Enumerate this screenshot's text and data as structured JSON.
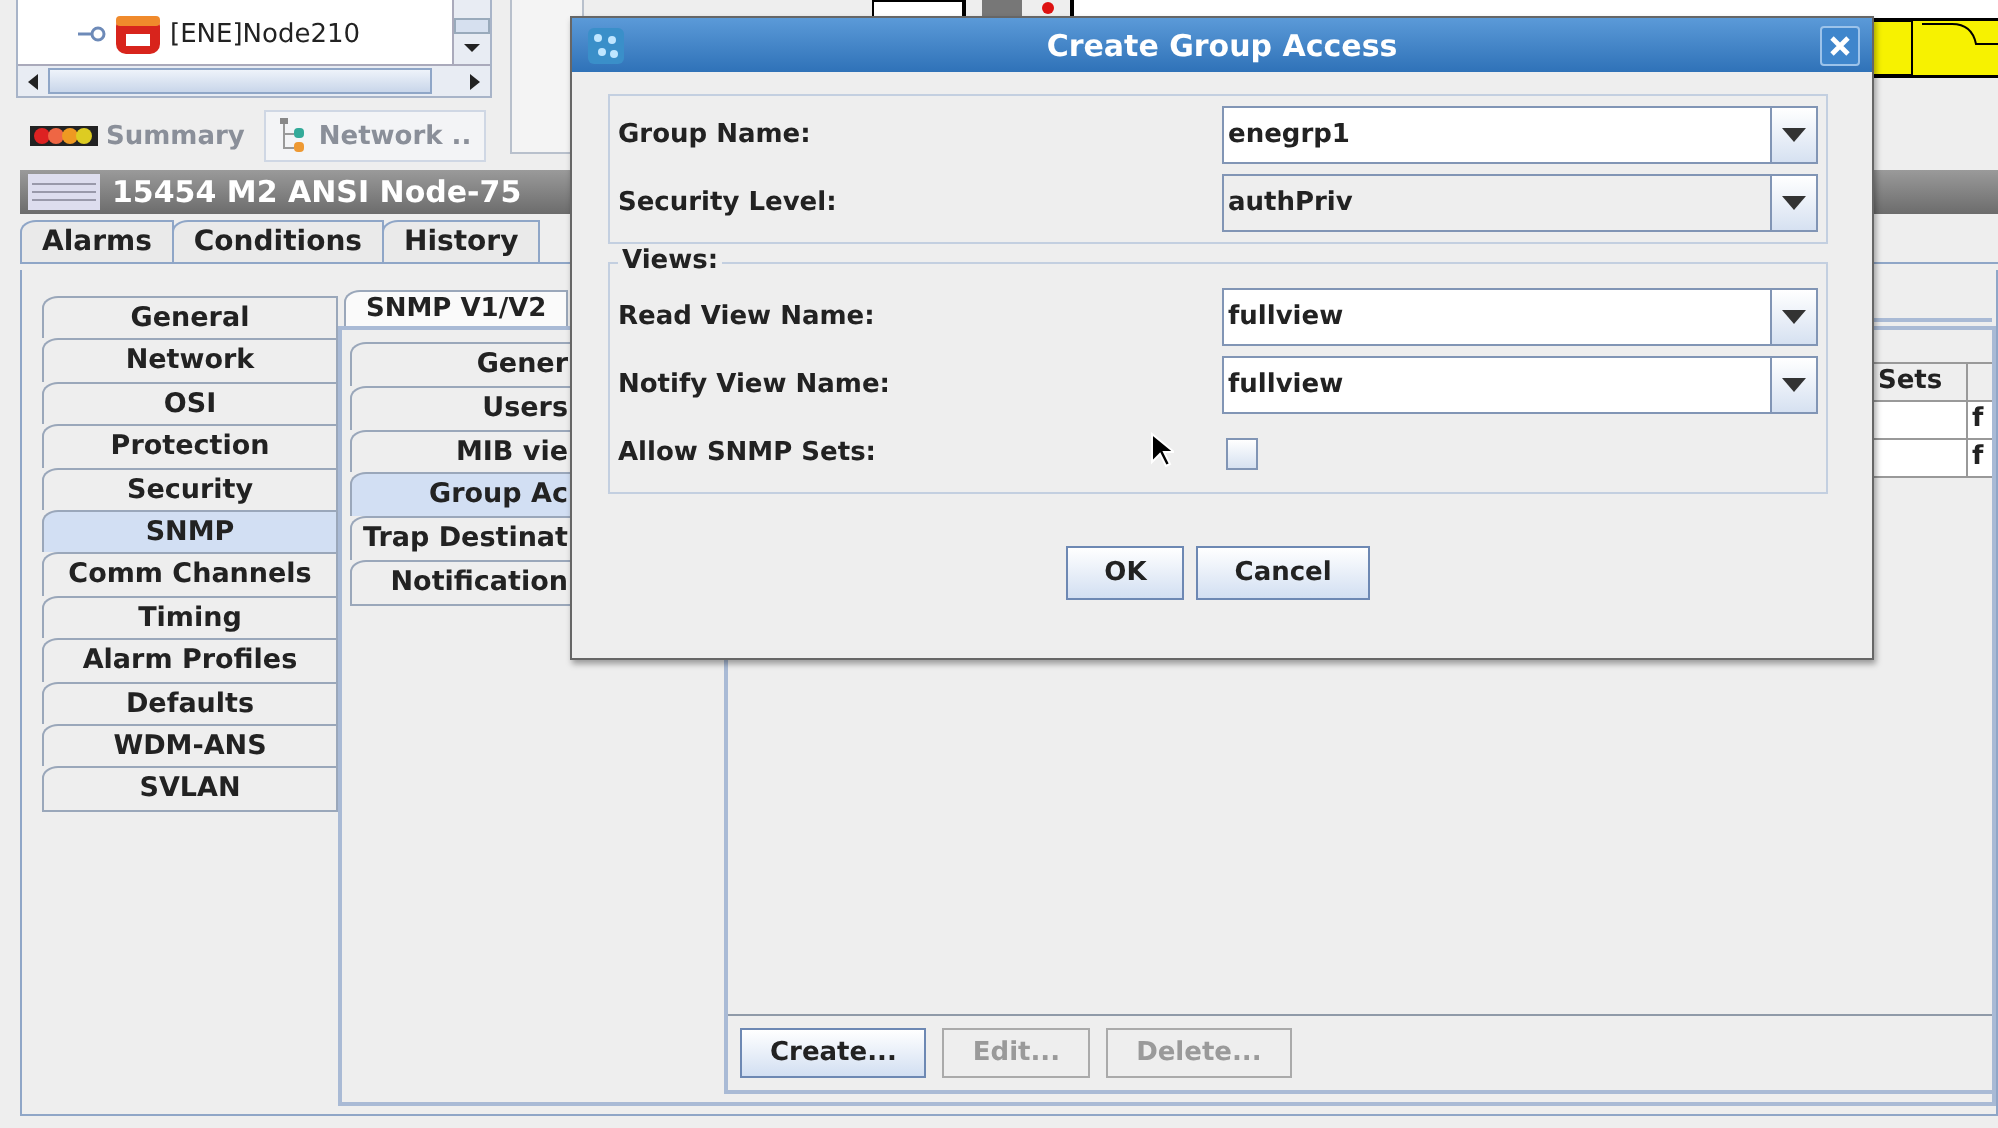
{
  "tree": {
    "items": [
      {
        "label": "[ENE]Node210"
      }
    ]
  },
  "view_tabs": [
    {
      "label": "Summary",
      "selected": false
    },
    {
      "label": "Network ..",
      "selected": true
    }
  ],
  "node_window": {
    "title": "15454 M2 ANSI Node-75",
    "tabs": [
      {
        "label": "Alarms",
        "selected": false
      },
      {
        "label": "Conditions",
        "selected": false
      },
      {
        "label": "History",
        "selected": false
      }
    ],
    "side_tabs": [
      {
        "label": "General",
        "selected": false
      },
      {
        "label": "Network",
        "selected": false
      },
      {
        "label": "OSI",
        "selected": false
      },
      {
        "label": "Protection",
        "selected": false
      },
      {
        "label": "Security",
        "selected": false
      },
      {
        "label": "SNMP",
        "selected": true
      },
      {
        "label": "Comm Channels",
        "selected": false
      },
      {
        "label": "Timing",
        "selected": false
      },
      {
        "label": "Alarm Profiles",
        "selected": false
      },
      {
        "label": "Defaults",
        "selected": false
      },
      {
        "label": "WDM-ANS",
        "selected": false
      },
      {
        "label": "SVLAN",
        "selected": false
      }
    ],
    "sub_tabs": [
      {
        "label": "SNMP V1/V2",
        "selected": true
      }
    ],
    "snmp_tabs": [
      {
        "label": "Gener",
        "selected": false
      },
      {
        "label": "Users",
        "selected": false
      },
      {
        "label": "MIB vie",
        "selected": false
      },
      {
        "label": "Group Ac",
        "selected": true
      },
      {
        "label": "Trap Destinat",
        "selected": false
      },
      {
        "label": "Notification",
        "selected": false
      }
    ],
    "table": {
      "header": "Sets",
      "rows": [
        "f",
        "f"
      ]
    },
    "buttons": [
      {
        "label": "Create...",
        "disabled": false
      },
      {
        "label": "Edit...",
        "disabled": true
      },
      {
        "label": "Delete...",
        "disabled": true
      }
    ]
  },
  "dialog": {
    "title": "Create Group Access",
    "fields": [
      {
        "kind": "editable",
        "label": "Group Name:",
        "value": "enegrp1"
      },
      {
        "kind": "combo",
        "label": "Security Level:",
        "value": "authPriv"
      }
    ],
    "views": {
      "title": "Views:",
      "fields": [
        {
          "kind": "editable",
          "label": "Read View Name:",
          "value": "fullview"
        },
        {
          "kind": "editable",
          "label": "Notify View Name:",
          "value": "fullview"
        },
        {
          "kind": "checkbox",
          "label": "Allow SNMP Sets:",
          "checked": false
        }
      ]
    },
    "buttons": [
      {
        "label": "OK"
      },
      {
        "label": "Cancel"
      }
    ]
  }
}
